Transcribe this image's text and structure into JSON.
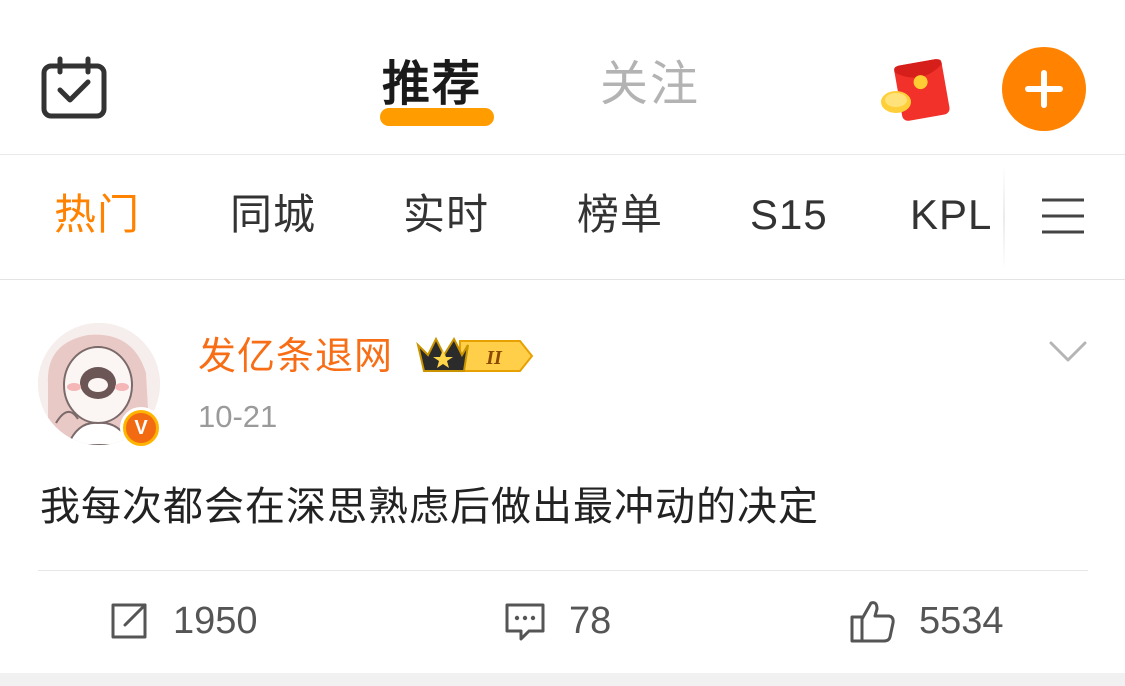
{
  "header": {
    "tabs": [
      {
        "label": "推荐",
        "active": true
      },
      {
        "label": "关注",
        "active": false
      }
    ],
    "accent_color": "#ff8200",
    "icons": {
      "checkin": "calendar-check-icon",
      "redpacket": "red-envelope-icon",
      "compose": "plus-icon"
    }
  },
  "channels": {
    "items": [
      {
        "label": "热门",
        "active": true
      },
      {
        "label": "同城",
        "active": false
      },
      {
        "label": "实时",
        "active": false
      },
      {
        "label": "榜单",
        "active": false
      },
      {
        "label": "S15",
        "active": false
      },
      {
        "label": "KPL",
        "active": false
      }
    ],
    "menu_icon": "menu-lines-icon"
  },
  "post": {
    "username": "发亿条退网",
    "vip_level": "II",
    "time": "10-21",
    "text": "我每次都会在深思熟虑后做出最冲动的决定",
    "actions": {
      "repost_count": "1950",
      "comment_count": "78",
      "like_count": "5534"
    }
  }
}
